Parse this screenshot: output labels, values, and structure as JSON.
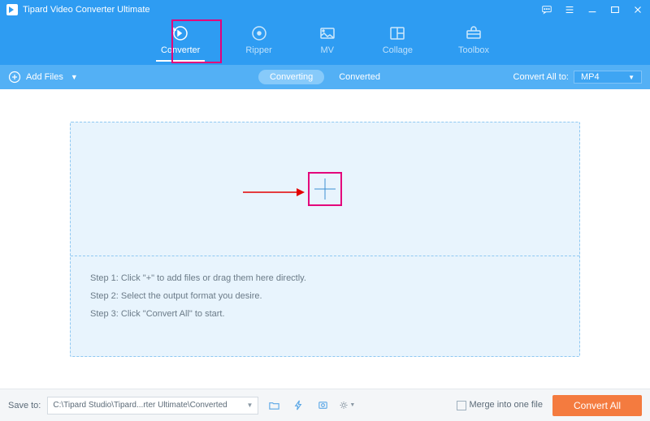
{
  "app": {
    "title": "Tipard Video Converter Ultimate"
  },
  "nav": {
    "tabs": [
      {
        "label": "Converter"
      },
      {
        "label": "Ripper"
      },
      {
        "label": "MV"
      },
      {
        "label": "Collage"
      },
      {
        "label": "Toolbox"
      }
    ]
  },
  "toolbar": {
    "add_files": "Add Files",
    "converting": "Converting",
    "converted": "Converted",
    "convert_all_to": "Convert All to:",
    "format": "MP4"
  },
  "dropzone": {
    "step1": "Step 1: Click \"+\" to add files or drag them here directly.",
    "step2": "Step 2: Select the output format you desire.",
    "step3": "Step 3: Click \"Convert All\" to start."
  },
  "footer": {
    "save_to": "Save to:",
    "path": "C:\\Tipard Studio\\Tipard...rter Ultimate\\Converted",
    "merge": "Merge into one file",
    "convert_all": "Convert All"
  }
}
